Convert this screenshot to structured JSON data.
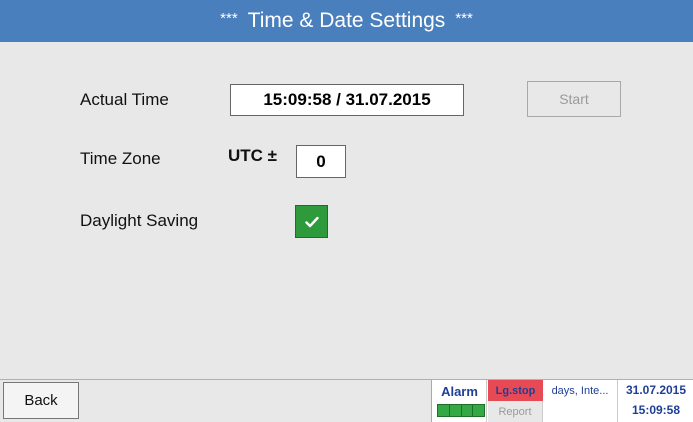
{
  "title": {
    "stars_left": "***",
    "text": "Time & Date Settings",
    "stars_right": "***"
  },
  "form": {
    "actual_time_label": "Actual Time",
    "actual_time_value": "15:09:58 / 31.07.2015",
    "start_label": "Start",
    "time_zone_label": "Time Zone",
    "utc_label": "UTC ±",
    "utc_offset_value": "0",
    "daylight_saving_label": "Daylight Saving",
    "daylight_saving_checked": true
  },
  "footer": {
    "back_label": "Back",
    "alarm_label": "Alarm",
    "lgstop_label": "Lg.stop",
    "report_label": "Report",
    "days_label": "days, Inte...",
    "date": "31.07.2015",
    "time": "15:09:58"
  },
  "colors": {
    "title_bar": "#4a7fbd",
    "checkbox": "#2e9a3c",
    "lgstop": "#e84a55",
    "status_text": "#1f3f96"
  }
}
